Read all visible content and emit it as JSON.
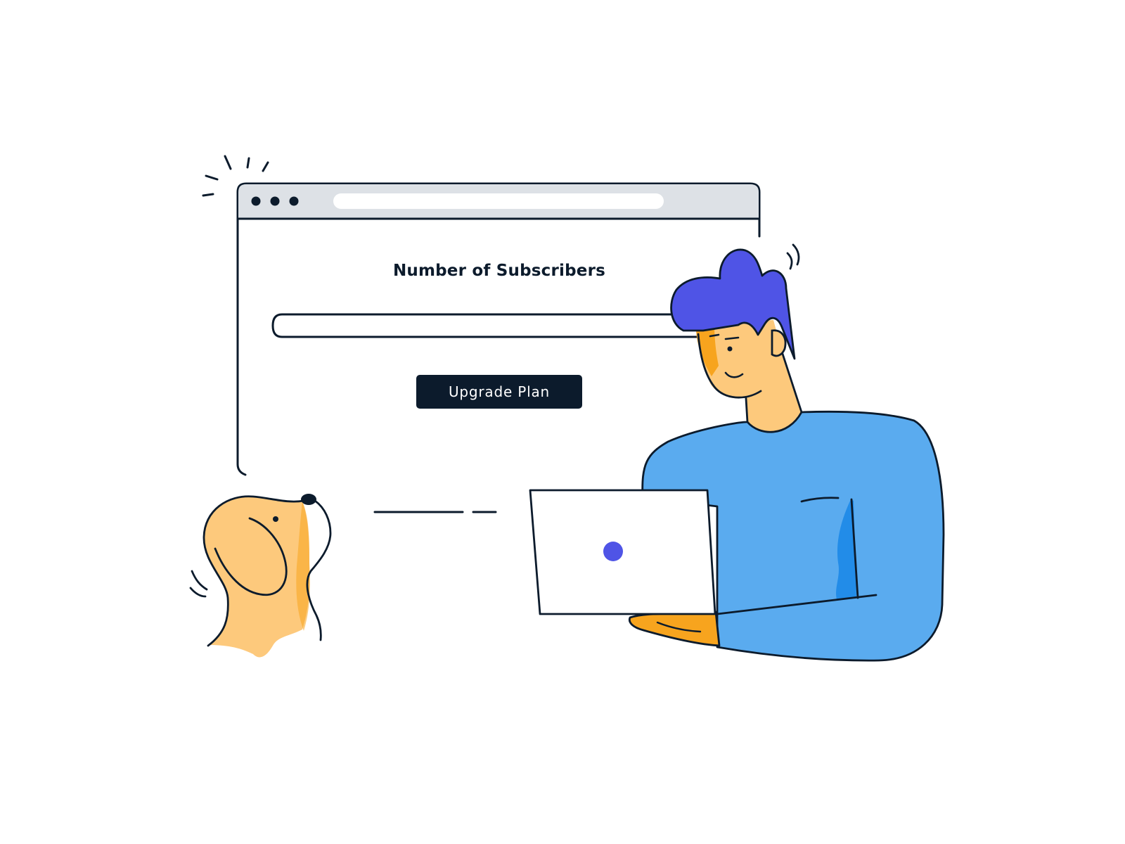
{
  "form": {
    "heading": "Number of Subscribers",
    "subscribers_value": "",
    "upgrade_label": "Upgrade Plan"
  },
  "colors": {
    "outline": "#0c1b2c",
    "toolbar": "#dde1e6",
    "hair": "#4f54e6",
    "shirt": "#5aabef",
    "shirt_shadow": "#228ce8",
    "skin": "#fdc97c",
    "skin_shadow": "#f7a41e",
    "accent_dot": "#4f54e6"
  },
  "icons": {
    "window_dots": "three-dots-icon",
    "sparkle": "sparkle-lines-icon"
  }
}
